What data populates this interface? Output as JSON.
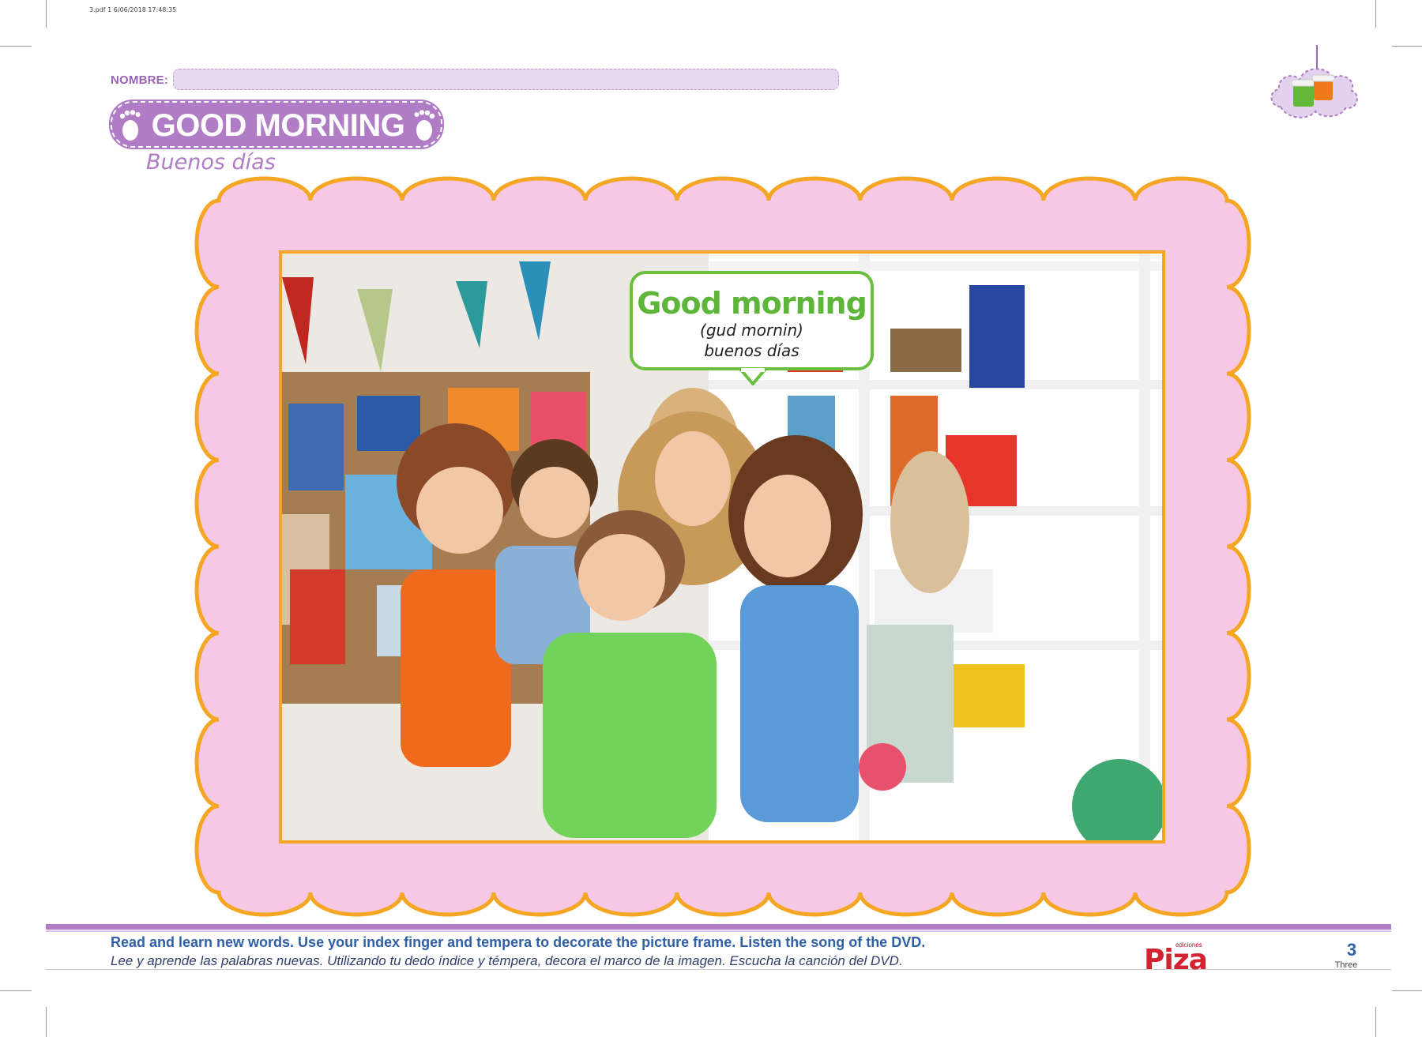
{
  "print_info": "3.pdf   1   6/06/2018   17:48:35",
  "header": {
    "name_label": "NOMBRE:",
    "title": "GOOD MORNING",
    "subtitle": "Buenos días"
  },
  "bubble": {
    "word": "Good morning",
    "pronunciation": "(gud mornin)",
    "translation": "buenos días"
  },
  "instructions": {
    "english": "Read and learn new words. Use your index finger and tempera to decorate the picture frame. Listen the song of the DVD.",
    "spanish": "Lee y aprende las palabras nuevas. Utilizando tu dedo índice y témpera, decora el marco de la imagen. Escucha la canción del DVD."
  },
  "footer": {
    "logo_small": "ediciones",
    "logo": "Piza",
    "page_number": "3",
    "page_word": "Three"
  },
  "colors": {
    "title_purple": "#b07cc6",
    "frame_pink": "#f7c8e4",
    "frame_orange": "#f5a623",
    "bubble_green": "#5db53a",
    "text_blue": "#2f5fa8"
  }
}
